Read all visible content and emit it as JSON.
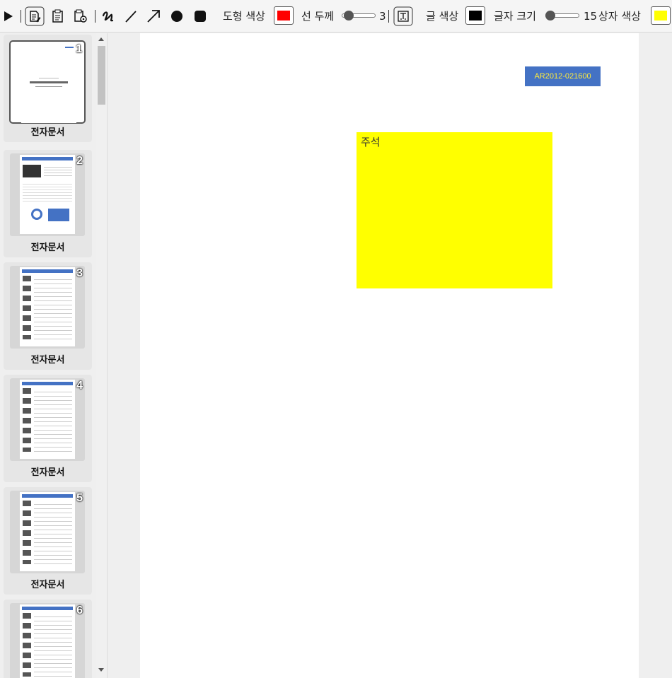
{
  "toolbar": {
    "icons": [
      "play-icon",
      "edit-document-icon",
      "clipboard-icon",
      "clipboard-settings-icon",
      "freehand-icon",
      "line-icon",
      "arrow-icon",
      "circle-icon",
      "rectangle-icon",
      "text-box-icon"
    ],
    "shape_color_label": "도형 색상",
    "shape_color": "#ff0000",
    "line_width_label": "선 두께",
    "line_width_value": "3",
    "line_width_level": 0.1,
    "text_color_label": "글 색상",
    "text_color": "#000000",
    "font_size_label": "글자 크기",
    "font_size_value": "15",
    "font_size_level": 0.0,
    "box_color_label": "상자 색상",
    "box_color": "#ffff00"
  },
  "sidebar": {
    "pages": [
      {
        "number": "1",
        "caption": "전자문서",
        "selected": true
      },
      {
        "number": "2",
        "caption": "전자문서"
      },
      {
        "number": "3",
        "caption": "전자문서"
      },
      {
        "number": "4",
        "caption": "전자문서"
      },
      {
        "number": "5",
        "caption": "전자문서"
      },
      {
        "number": "6",
        "caption": ""
      }
    ]
  },
  "document": {
    "doc_id": "AR2012-021600",
    "note_text": "주석",
    "note_color": "#ffff00",
    "id_bg": "#4472c4"
  }
}
